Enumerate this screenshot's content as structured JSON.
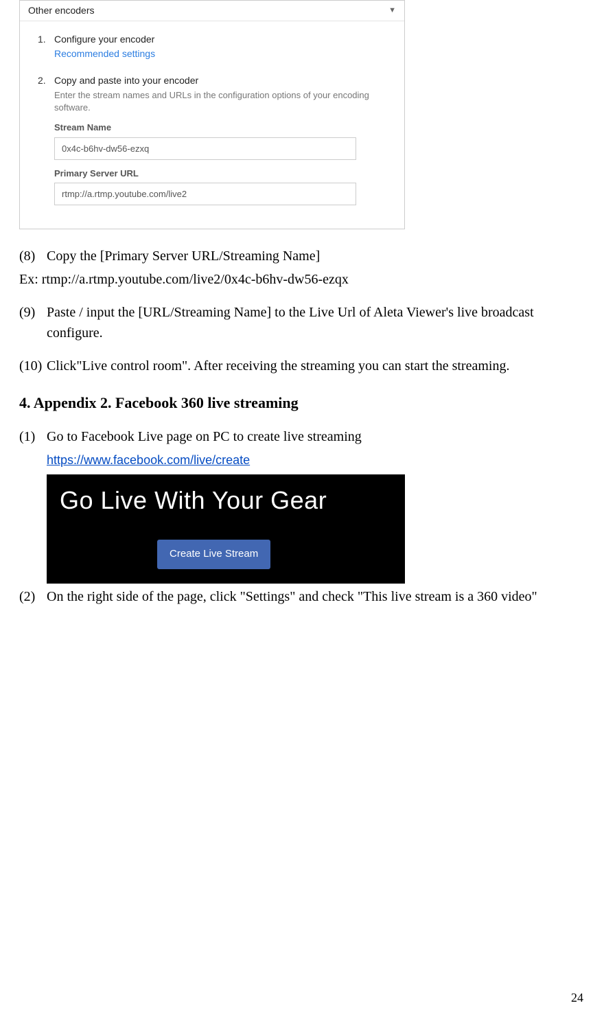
{
  "yt": {
    "dropdown_label": "Other encoders",
    "step1": {
      "num": "1.",
      "title": "Configure your encoder",
      "link": "Recommended settings"
    },
    "step2": {
      "num": "2.",
      "title": "Copy and paste into your encoder",
      "desc": "Enter the stream names and URLs in the configuration options of your encoding software.",
      "stream_label": "Stream Name",
      "stream_value": "0x4c-b6hv-dw56-ezxq",
      "url_label": "Primary Server URL",
      "url_value": "rtmp://a.rtmp.youtube.com/live2"
    }
  },
  "doc": {
    "step8_num": "(8)",
    "step8_text": "Copy the [Primary Server URL/Streaming Name]",
    "step8_ex": "Ex: rtmp://a.rtmp.youtube.com/live2/0x4c-b6hv-dw56-ezqx",
    "step9_num": "(9)",
    "step9_text": "Paste / input the [URL/Streaming Name] to the Live Url of Aleta Viewer's live broadcast configure.",
    "step10_num": "(10)",
    "step10_text": "Click\"Live control room\". After receiving the streaming you can start the streaming.",
    "heading": "4. Appendix 2. Facebook 360 live streaming",
    "fb_step1_num": "(1)",
    "fb_step1_text": "Go to Facebook Live page on PC to create live streaming",
    "fb_url": "https://www.facebook.com/live/create",
    "fb_banner_title": "Go Live With Your Gear",
    "fb_button": "Create Live Stream",
    "fb_step2_num": "(2)",
    "fb_step2_text": "On the right side of the page, click \"Settings\" and check \"This live stream is a 360 video\"",
    "page_number": "24"
  }
}
